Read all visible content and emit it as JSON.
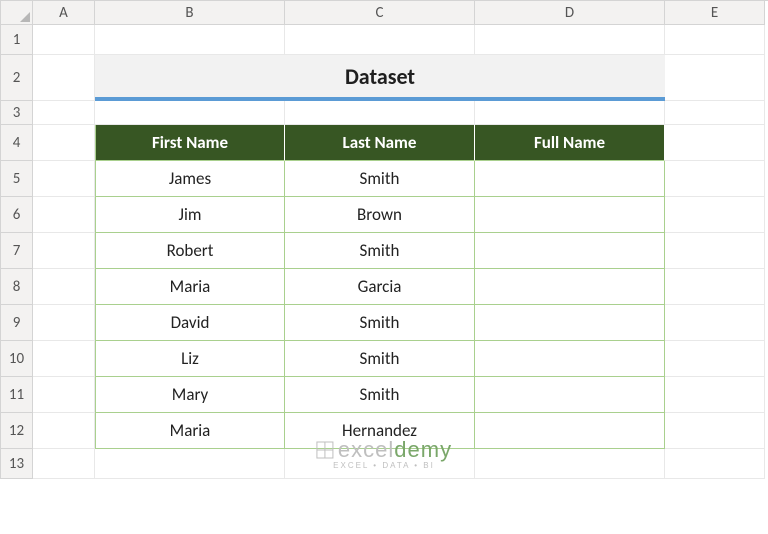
{
  "columns": [
    "A",
    "B",
    "C",
    "D",
    "E"
  ],
  "rows": [
    "1",
    "2",
    "3",
    "4",
    "5",
    "6",
    "7",
    "8",
    "9",
    "10",
    "11",
    "12",
    "13"
  ],
  "title": "Dataset",
  "headers": [
    "First Name",
    "Last Name",
    "Full Name"
  ],
  "data": [
    {
      "first": "James",
      "last": "Smith",
      "full": ""
    },
    {
      "first": "Jim",
      "last": "Brown",
      "full": ""
    },
    {
      "first": "Robert",
      "last": "Smith",
      "full": ""
    },
    {
      "first": "Maria",
      "last": "Garcia",
      "full": ""
    },
    {
      "first": "David",
      "last": "Smith",
      "full": ""
    },
    {
      "first": "Liz",
      "last": "Smith",
      "full": ""
    },
    {
      "first": "Mary",
      "last": "Smith",
      "full": ""
    },
    {
      "first": "Maria",
      "last": "Hernandez",
      "full": ""
    }
  ],
  "watermark": {
    "brand_a": "excel",
    "brand_b": "demy",
    "tagline": "EXCEL • DATA • BI"
  },
  "chart_data": {
    "type": "table",
    "title": "Dataset",
    "columns": [
      "First Name",
      "Last Name",
      "Full Name"
    ],
    "rows": [
      [
        "James",
        "Smith",
        ""
      ],
      [
        "Jim",
        "Brown",
        ""
      ],
      [
        "Robert",
        "Smith",
        ""
      ],
      [
        "Maria",
        "Garcia",
        ""
      ],
      [
        "David",
        "Smith",
        ""
      ],
      [
        "Liz",
        "Smith",
        ""
      ],
      [
        "Mary",
        "Smith",
        ""
      ],
      [
        "Maria",
        "Hernandez",
        ""
      ]
    ]
  }
}
